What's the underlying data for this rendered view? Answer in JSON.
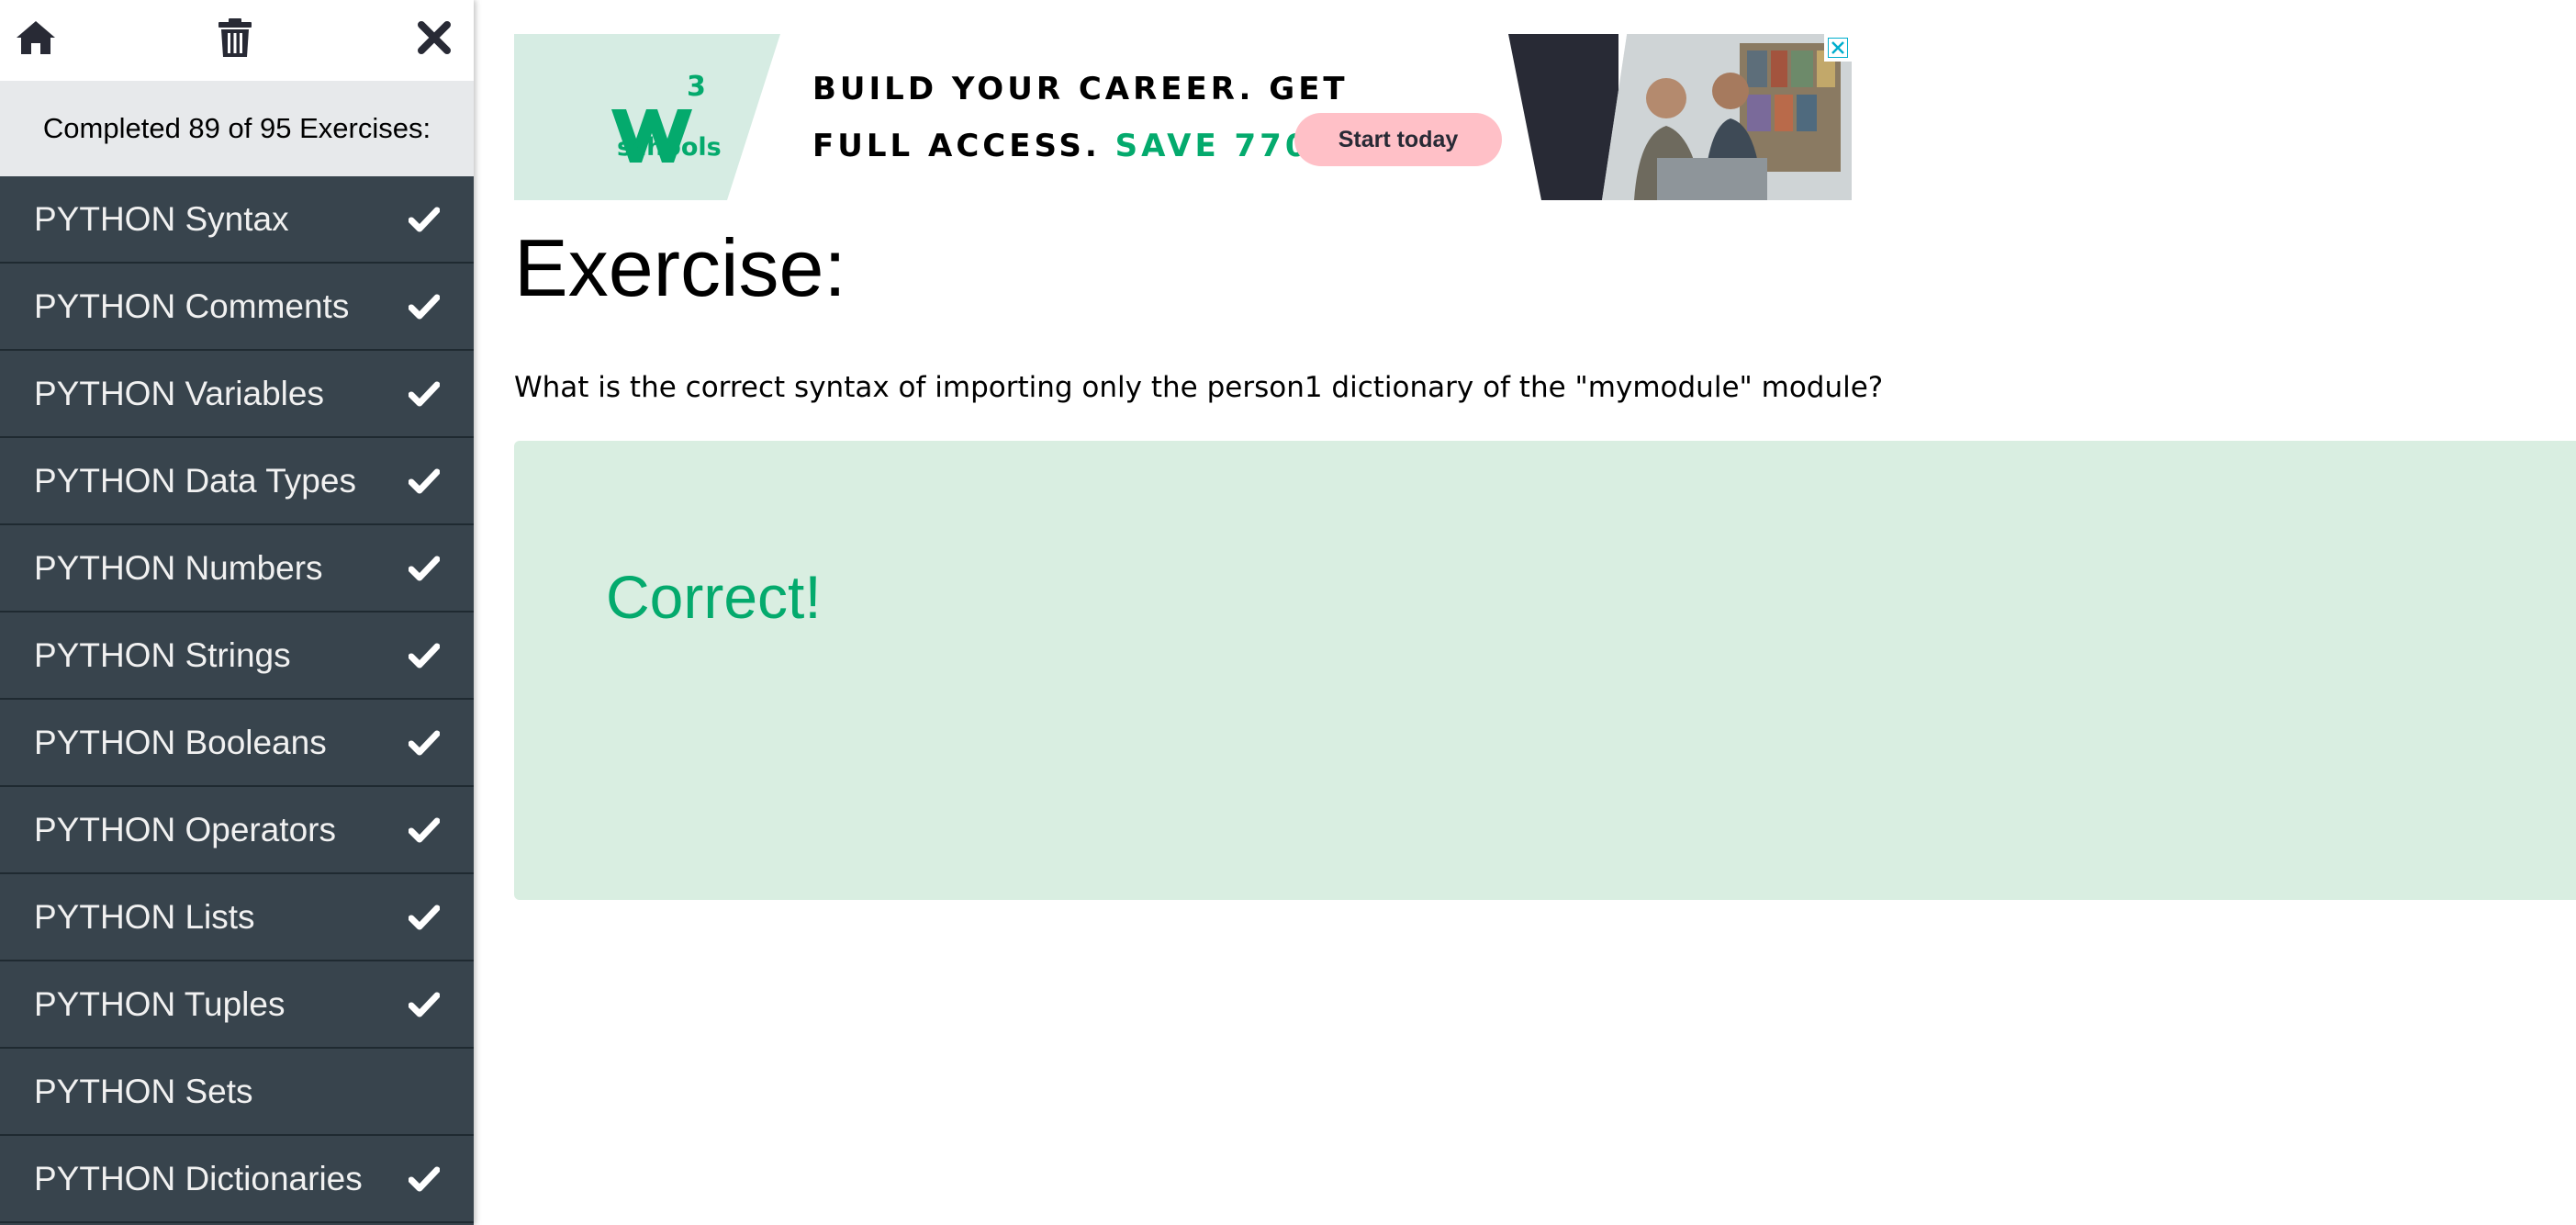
{
  "sidebar": {
    "top_icons": [
      "home-icon",
      "trash-icon",
      "close-icon"
    ],
    "progress_text": "Completed 89 of 95 Exercises:",
    "items": [
      {
        "label": "PYTHON Syntax",
        "completed": true
      },
      {
        "label": "PYTHON Comments",
        "completed": true
      },
      {
        "label": "PYTHON Variables",
        "completed": true
      },
      {
        "label": "PYTHON Data Types",
        "completed": true
      },
      {
        "label": "PYTHON Numbers",
        "completed": true
      },
      {
        "label": "PYTHON Strings",
        "completed": true
      },
      {
        "label": "PYTHON Booleans",
        "completed": true
      },
      {
        "label": "PYTHON Operators",
        "completed": true
      },
      {
        "label": "PYTHON Lists",
        "completed": true
      },
      {
        "label": "PYTHON Tuples",
        "completed": true
      },
      {
        "label": "PYTHON Sets",
        "completed": false
      },
      {
        "label": "PYTHON Dictionaries",
        "completed": true
      }
    ]
  },
  "ad": {
    "logo_text": "schools",
    "logo_superscript": "3",
    "line1": "BUILD YOUR CAREER. GET",
    "line2_prefix": "FULL ACCESS.",
    "line2_highlight": "SAVE 770$",
    "cta": "Start today",
    "close_icon": "ad-close-icon"
  },
  "main": {
    "title": "Exercise:",
    "question": "What is the correct syntax of importing only the person1 dictionary of the \"mymodule\" module?",
    "result": "Correct!"
  },
  "colors": {
    "sidebar_bg": "#38444d",
    "accent_green": "#04aa6d",
    "result_bg": "#d9eee1",
    "cta_bg": "#ffc0c7"
  }
}
